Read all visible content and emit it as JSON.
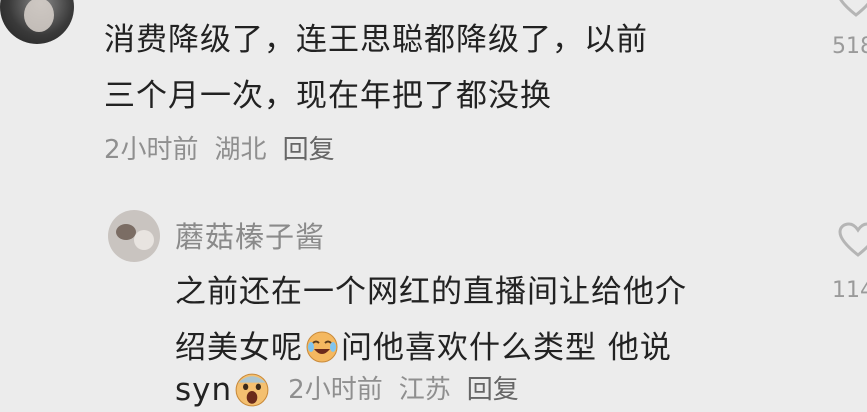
{
  "top_comment": {
    "lines": [
      "消费降级了，连王思聪都降级了，以前",
      "三个月一次，现在年把了都没换"
    ],
    "time": "2小时前",
    "location": "湖北",
    "reply_label": "回复",
    "like_count": "518"
  },
  "reply_comment": {
    "username": "蘑菇榛子酱",
    "line1": "之前还在一个网红的直播间让给他介",
    "line2_a": "绍美女呢",
    "line2_b": "问他喜欢什么类型 他说",
    "line3_a": "syn",
    "time": "2小时前",
    "location": "江苏",
    "reply_label": "回复",
    "like_count": "114"
  },
  "icons": {
    "like": "heart-outline-icon",
    "emoji1": "crying-laughing-emoji",
    "emoji2": "screaming-emoji"
  },
  "colors": {
    "background": "#ececec",
    "text": "#222222",
    "meta": "#8f8f8f"
  }
}
